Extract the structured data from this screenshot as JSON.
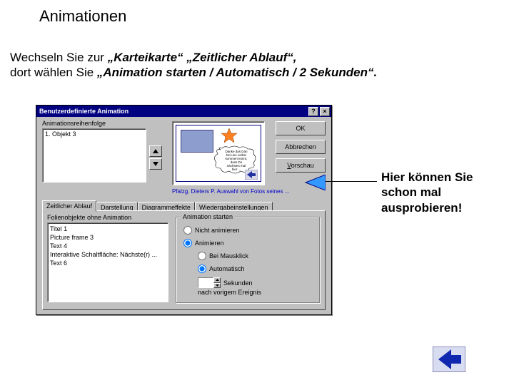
{
  "page": {
    "title": "Animationen",
    "instruction_line1_prefix": "Wechseln Sie zur ",
    "instruction_line1_em": "„Karteikarte“ „Zeitlicher Ablauf“,",
    "instruction_line2_prefix": "dort wählen Sie ",
    "instruction_line2_em": "„Animation starten / Automatisch / 2 Sekunden“.",
    "callout_l1": "Hier können Sie",
    "callout_l2": "schon mal",
    "callout_l3": "ausprobieren!"
  },
  "dialog": {
    "title": "Benutzerdefinierte Animation",
    "help_btn": "?",
    "close_btn": "×",
    "anim_order_label": "Animationsreihenfolge",
    "anim_order_items": [
      "1. Objekt 3"
    ],
    "preview_caption": "Pfalzg. Dieters P. Auswahl von Fotos seines ...",
    "buttons": {
      "ok": "OK",
      "cancel": "Abbrechen",
      "preview": "Vorschau"
    },
    "tabs": {
      "t0": "Zeitlicher Ablauf",
      "t1": "Darstellung",
      "t2": "Diagrammeffekte",
      "t3": "Wiedergabeinstellungen"
    },
    "noanim_label": "Folienobjekte ohne Animation",
    "noanim_items": [
      "Titel 1",
      "Picture frame 3",
      "Text 4",
      "Interaktive Schaltfläche: Nächste(r) ...",
      "Text 6"
    ],
    "group_title": "Animation starten",
    "radio_none": "Nicht animieren",
    "radio_animate": "Animieren",
    "radio_onclick": "Bei Mausklick",
    "radio_auto": "Automatisch",
    "seconds_value": "",
    "seconds_label": "Sekunden",
    "after_label": "nach vorigem Ereignis"
  },
  "thumb": {
    "bubble_l1": "Danke das Dan",
    "bubble_l2": "bei uns vorbei",
    "bubble_l3": "kommen könnt,",
    "bubble_l4": "dass Du",
    "bubble_l5": "nächstes mal",
    "bubble_l6": "hier ..."
  }
}
